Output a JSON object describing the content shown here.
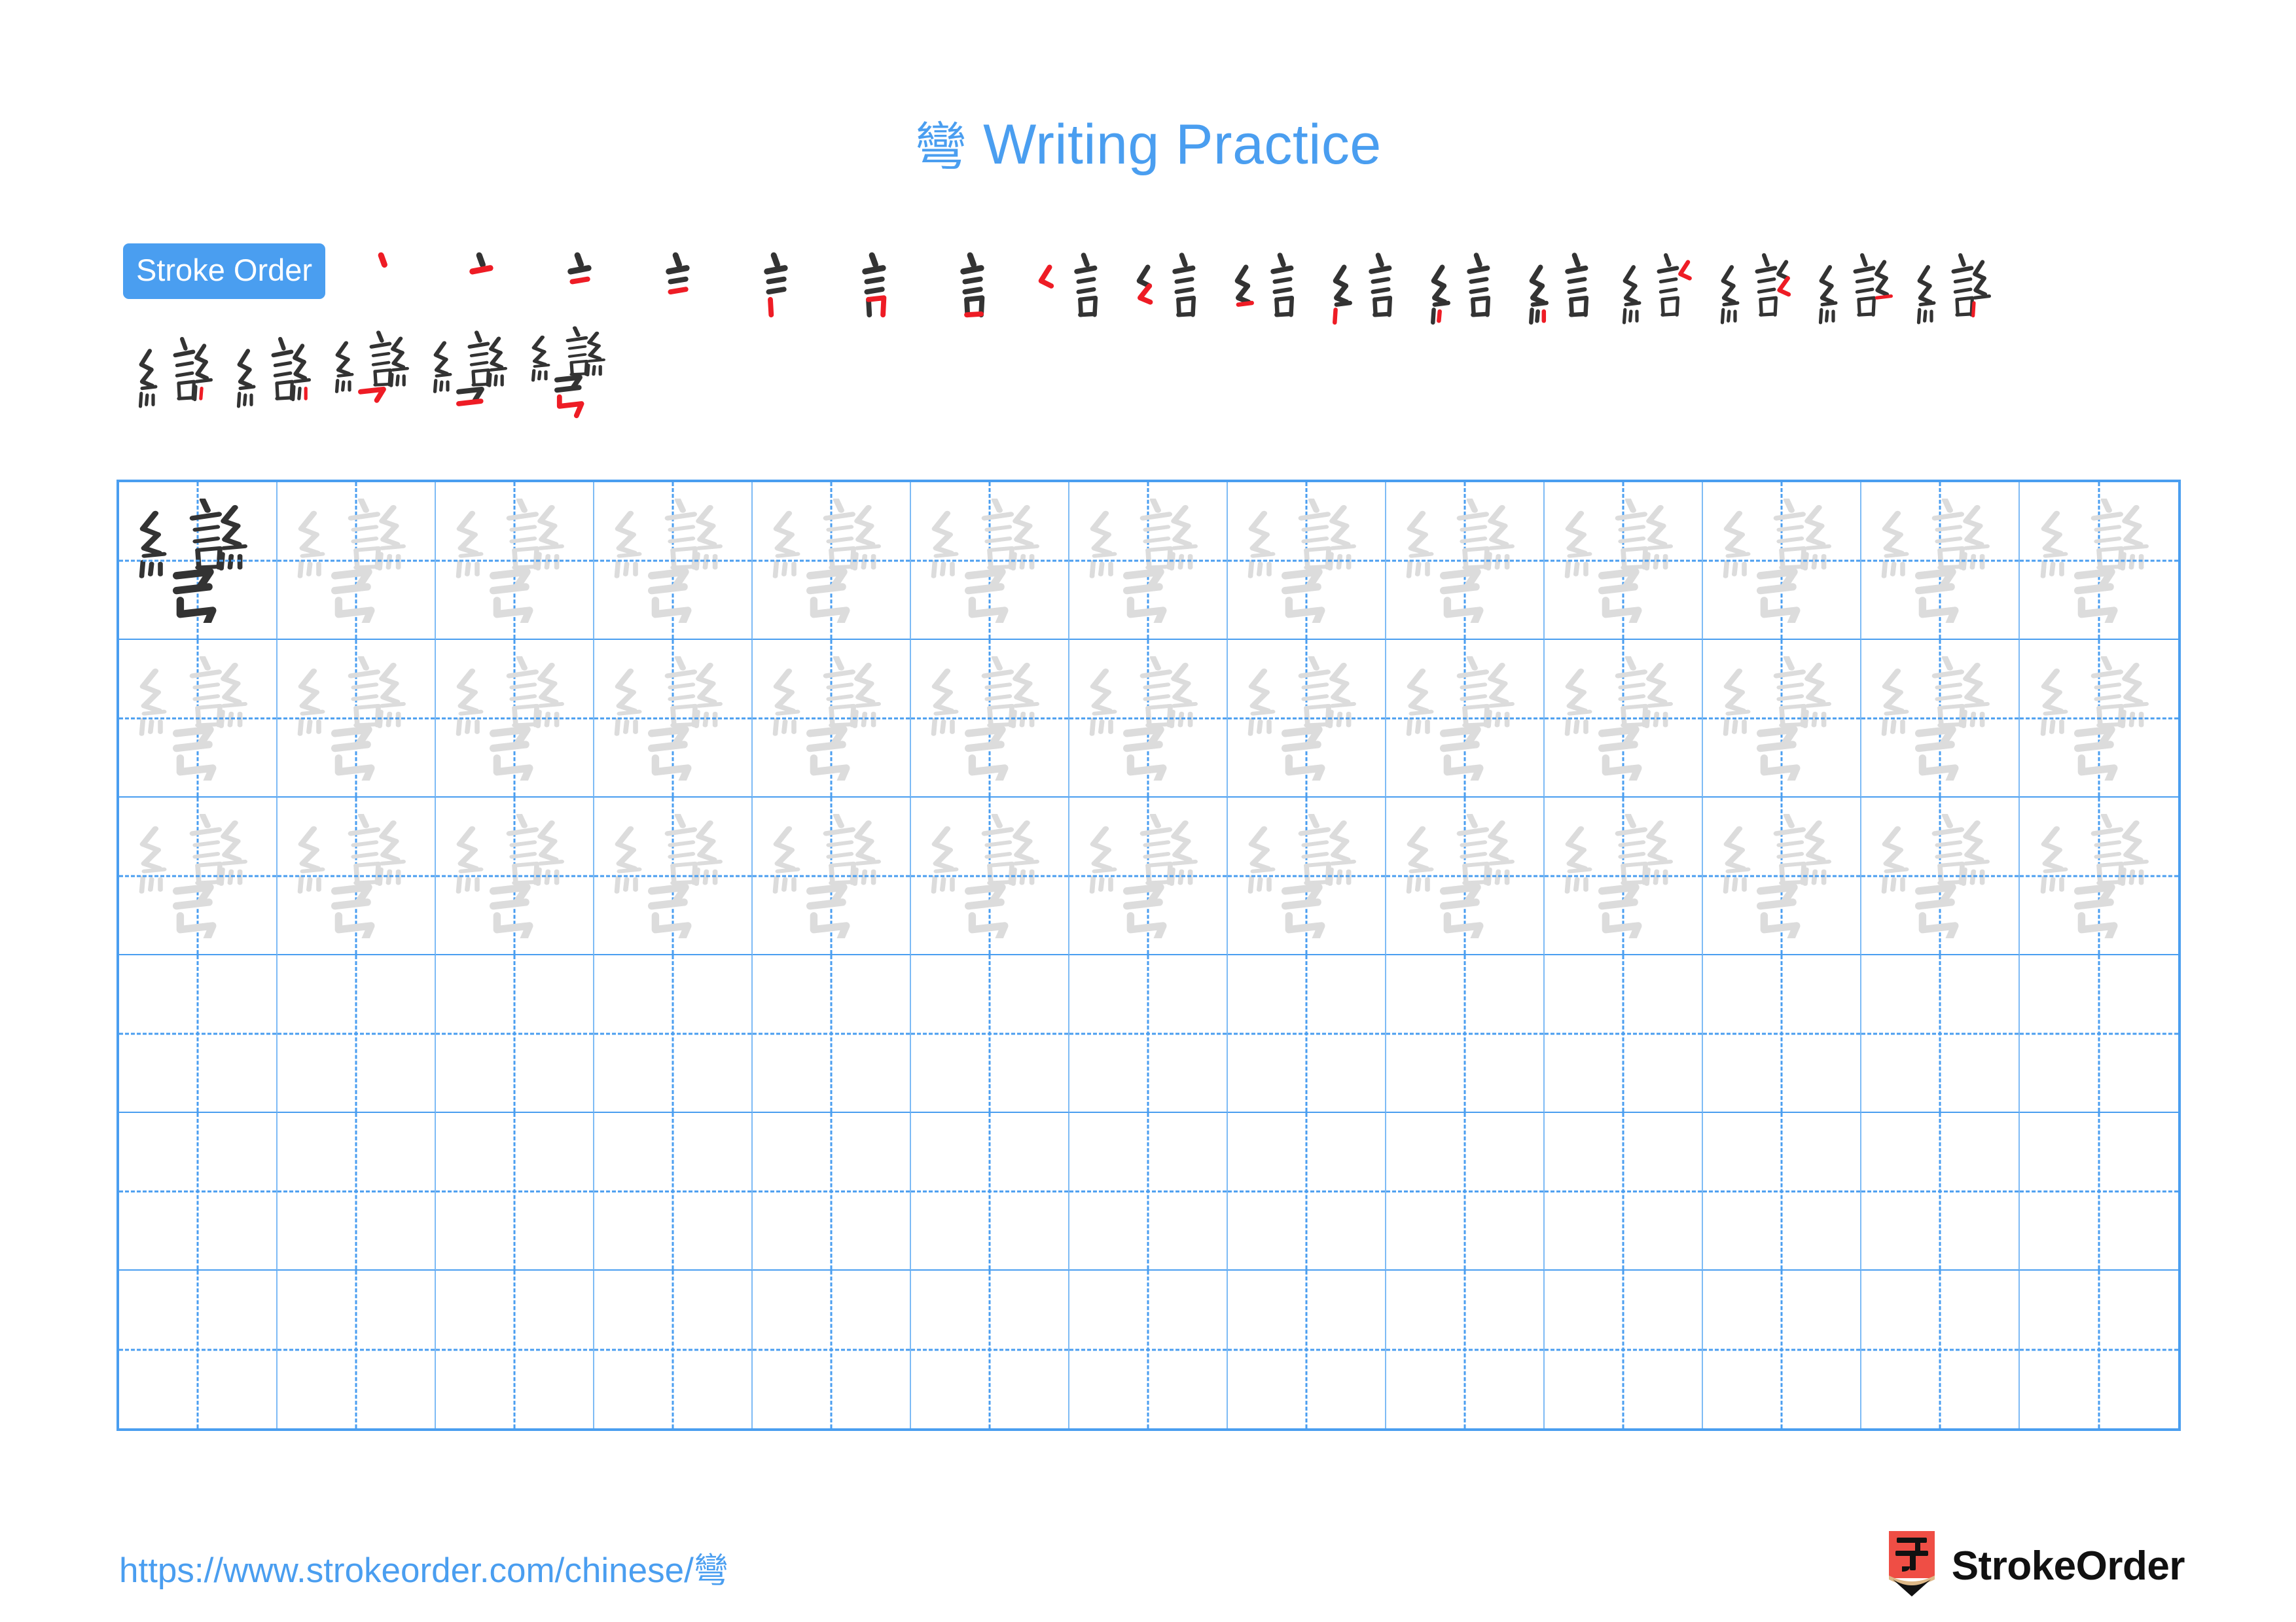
{
  "meta": {
    "character": "彎",
    "stroke_count": 22,
    "grid_columns": 13,
    "grid_rows": 6,
    "traced_rows": 3,
    "blank_rows": 3
  },
  "colors": {
    "accent_blue": "#4A9EF0",
    "grid_line_blue": "#7EBBF5",
    "new_stroke_red": "#EE1C25",
    "existing_stroke_black": "#333333",
    "trace_gray": "#DCDCDC",
    "logo_red": "#EF4E45",
    "logo_wood": "#DEB887",
    "logo_tip": "#111111"
  },
  "title": {
    "character": "彎",
    "text": " Writing Practice",
    "full": "彎 Writing Practice"
  },
  "stroke_order": {
    "badge_label": "Stroke Order",
    "total_steps": 22,
    "row1_count": 17,
    "row2_count": 5,
    "steps": [
      {
        "index": 1,
        "stroke_name": "dian"
      },
      {
        "index": 2,
        "stroke_name": "heng"
      },
      {
        "index": 3,
        "stroke_name": "heng"
      },
      {
        "index": 4,
        "stroke_name": "heng"
      },
      {
        "index": 5,
        "stroke_name": "shu"
      },
      {
        "index": 6,
        "stroke_name": "heng-zhe"
      },
      {
        "index": 7,
        "stroke_name": "heng"
      },
      {
        "index": 8,
        "stroke_name": "pie-zhe"
      },
      {
        "index": 9,
        "stroke_name": "pie-zhe"
      },
      {
        "index": 10,
        "stroke_name": "heng"
      },
      {
        "index": 11,
        "stroke_name": "shu"
      },
      {
        "index": 12,
        "stroke_name": "dian"
      },
      {
        "index": 13,
        "stroke_name": "dian"
      },
      {
        "index": 14,
        "stroke_name": "pie-zhe"
      },
      {
        "index": 15,
        "stroke_name": "pie-zhe"
      },
      {
        "index": 16,
        "stroke_name": "heng"
      },
      {
        "index": 17,
        "stroke_name": "shu"
      },
      {
        "index": 18,
        "stroke_name": "dian"
      },
      {
        "index": 19,
        "stroke_name": "dian"
      },
      {
        "index": 20,
        "stroke_name": "heng-pie"
      },
      {
        "index": 21,
        "stroke_name": "heng"
      },
      {
        "index": 22,
        "stroke_name": "shu-zhe-zhe-gou"
      }
    ]
  },
  "practice_grid": {
    "columns": 13,
    "rows": 6,
    "cells": [
      [
        "dark",
        "trace",
        "trace",
        "trace",
        "trace",
        "trace",
        "trace",
        "trace",
        "trace",
        "trace",
        "trace",
        "trace",
        "trace"
      ],
      [
        "trace",
        "trace",
        "trace",
        "trace",
        "trace",
        "trace",
        "trace",
        "trace",
        "trace",
        "trace",
        "trace",
        "trace",
        "trace"
      ],
      [
        "trace",
        "trace",
        "trace",
        "trace",
        "trace",
        "trace",
        "trace",
        "trace",
        "trace",
        "trace",
        "trace",
        "trace",
        "trace"
      ],
      [
        "empty",
        "empty",
        "empty",
        "empty",
        "empty",
        "empty",
        "empty",
        "empty",
        "empty",
        "empty",
        "empty",
        "empty",
        "empty"
      ],
      [
        "empty",
        "empty",
        "empty",
        "empty",
        "empty",
        "empty",
        "empty",
        "empty",
        "empty",
        "empty",
        "empty",
        "empty",
        "empty"
      ],
      [
        "empty",
        "empty",
        "empty",
        "empty",
        "empty",
        "empty",
        "empty",
        "empty",
        "empty",
        "empty",
        "empty",
        "empty",
        "empty"
      ]
    ]
  },
  "footer": {
    "url_prefix": "https://www.strokeorder.com/chinese/",
    "url_character": "彎",
    "url_full": "https://www.strokeorder.com/chinese/彎",
    "brand_name": "StrokeOrder",
    "brand_mark_character": "字"
  }
}
